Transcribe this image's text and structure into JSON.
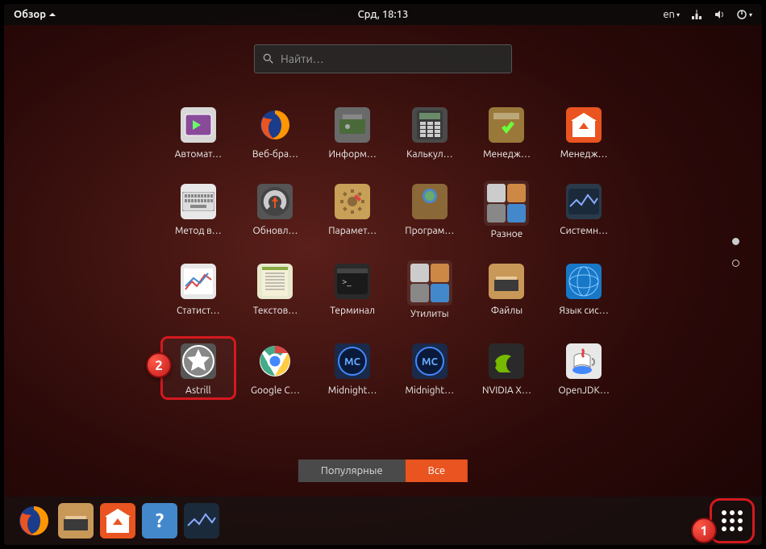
{
  "topbar": {
    "activities": "Обзор",
    "clock": "Срд, 18:13",
    "lang": "en"
  },
  "search": {
    "placeholder": "Найти…"
  },
  "apps": [
    {
      "label": "Автомат…",
      "icon": "automount",
      "bg": "#d8d8d8"
    },
    {
      "label": "Веб-бра…",
      "icon": "firefox",
      "bg": "transparent"
    },
    {
      "label": "Информ…",
      "icon": "hardinfo",
      "bg": "#6a6a6a"
    },
    {
      "label": "Калькул…",
      "icon": "calculator",
      "bg": "#4a4a4a"
    },
    {
      "label": "Менедж…",
      "icon": "package",
      "bg": "#9a783a"
    },
    {
      "label": "Менедж…",
      "icon": "software",
      "bg": "#e95420"
    },
    {
      "label": "Метод в…",
      "icon": "keyboard",
      "bg": "#e8e8e8"
    },
    {
      "label": "Обновл…",
      "icon": "updater",
      "bg": "#555"
    },
    {
      "label": "Парамет…",
      "icon": "settings",
      "bg": "#c8a058"
    },
    {
      "label": "Програм…",
      "icon": "globe-box",
      "bg": "#8a6838"
    },
    {
      "label": "Разное",
      "icon": "folder1",
      "bg": "folder"
    },
    {
      "label": "Системн…",
      "icon": "monitor",
      "bg": "#2a3a4a"
    },
    {
      "label": "Статист…",
      "icon": "stats",
      "bg": "#e8e8e8"
    },
    {
      "label": "Текстов…",
      "icon": "gedit",
      "bg": "#e8e8cc"
    },
    {
      "label": "Терминал",
      "icon": "terminal",
      "bg": "#2a2a2a"
    },
    {
      "label": "Утилиты",
      "icon": "folder2",
      "bg": "folder"
    },
    {
      "label": "Файлы",
      "icon": "files",
      "bg": "#c89858"
    },
    {
      "label": "Язык сис…",
      "icon": "language",
      "bg": "#1878c8"
    },
    {
      "label": "Astrill",
      "icon": "astrill",
      "bg": "#555",
      "hl": true
    },
    {
      "label": "Google C…",
      "icon": "chrome",
      "bg": "transparent"
    },
    {
      "label": "Midnight…",
      "icon": "mc1",
      "bg": "#1a2a4a"
    },
    {
      "label": "Midnight…",
      "icon": "mc2",
      "bg": "#1a2a4a"
    },
    {
      "label": "NVIDIA X…",
      "icon": "nvidia",
      "bg": "#2a2a2a"
    },
    {
      "label": "OpenJDK…",
      "icon": "java",
      "bg": "#e8e8e8"
    }
  ],
  "tabs": {
    "popular": "Популярные",
    "all": "Все"
  },
  "dock": [
    {
      "name": "firefox",
      "icon": "firefox"
    },
    {
      "name": "files",
      "icon": "files"
    },
    {
      "name": "software",
      "icon": "software"
    },
    {
      "name": "help",
      "icon": "help"
    },
    {
      "name": "monitor",
      "icon": "monitor"
    }
  ],
  "badges": {
    "b1": "1",
    "b2": "2"
  }
}
